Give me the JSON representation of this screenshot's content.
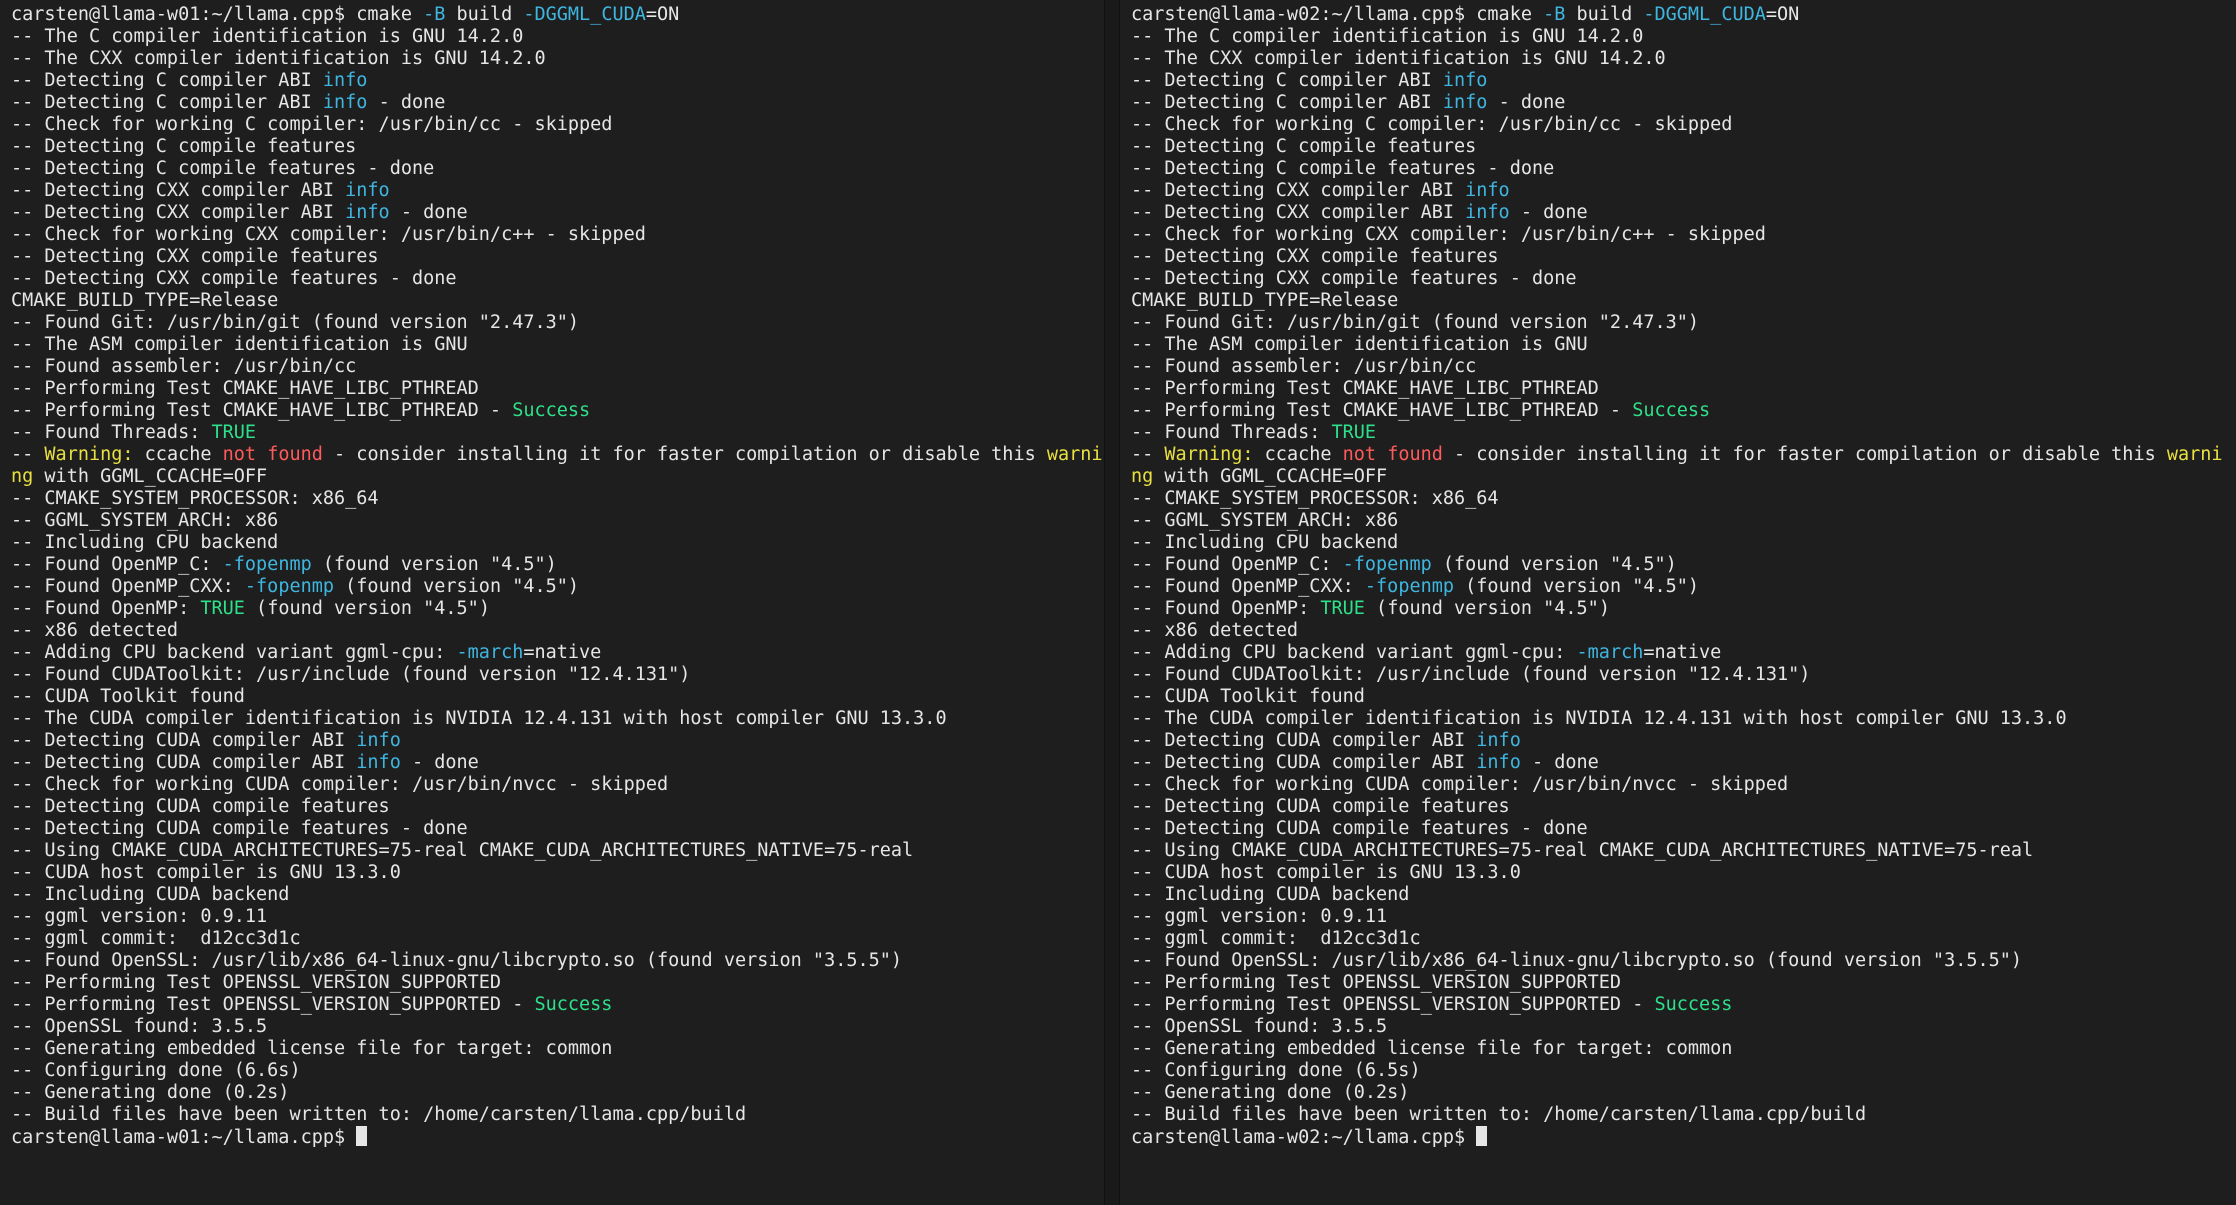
{
  "theme": {
    "background": "#1e1e1e",
    "foreground": "#e6e6e6",
    "info_color": "#3fb6e0",
    "success_color": "#2fe08a",
    "warning_color": "#e8e040",
    "error_color": "#ff5b5b"
  },
  "panes": [
    {
      "host": "llama-w01",
      "lines": [
        [
          {
            "t": "carsten@llama-w01:~/llama.cpp$ cmake "
          },
          {
            "t": "-B",
            "c": "cyan"
          },
          {
            "t": " build "
          },
          {
            "t": "-DGGML_CUDA",
            "c": "cyan"
          },
          {
            "t": "=ON"
          }
        ],
        [
          {
            "t": "-- The C compiler identification is GNU 14.2.0"
          }
        ],
        [
          {
            "t": "-- The CXX compiler identification is GNU 14.2.0"
          }
        ],
        [
          {
            "t": "-- Detecting C compiler ABI "
          },
          {
            "t": "info",
            "c": "cyan"
          }
        ],
        [
          {
            "t": "-- Detecting C compiler ABI "
          },
          {
            "t": "info",
            "c": "cyan"
          },
          {
            "t": " - done"
          }
        ],
        [
          {
            "t": "-- Check for working C compiler: /usr/bin/cc - skipped"
          }
        ],
        [
          {
            "t": "-- Detecting C compile features"
          }
        ],
        [
          {
            "t": "-- Detecting C compile features - done"
          }
        ],
        [
          {
            "t": "-- Detecting CXX compiler ABI "
          },
          {
            "t": "info",
            "c": "cyan"
          }
        ],
        [
          {
            "t": "-- Detecting CXX compiler ABI "
          },
          {
            "t": "info",
            "c": "cyan"
          },
          {
            "t": " - done"
          }
        ],
        [
          {
            "t": "-- Check for working CXX compiler: /usr/bin/c++ - skipped"
          }
        ],
        [
          {
            "t": "-- Detecting CXX compile features"
          }
        ],
        [
          {
            "t": "-- Detecting CXX compile features - done"
          }
        ],
        [
          {
            "t": "CMAKE_BUILD_TYPE=Release"
          }
        ],
        [
          {
            "t": "-- Found Git: /usr/bin/git (found version \"2.47.3\")"
          }
        ],
        [
          {
            "t": "-- The ASM compiler identification is GNU"
          }
        ],
        [
          {
            "t": "-- Found assembler: /usr/bin/cc"
          }
        ],
        [
          {
            "t": "-- Performing Test CMAKE_HAVE_LIBC_PTHREAD"
          }
        ],
        [
          {
            "t": "-- Performing Test CMAKE_HAVE_LIBC_PTHREAD - "
          },
          {
            "t": "Success",
            "c": "green"
          }
        ],
        [
          {
            "t": "-- Found Threads: "
          },
          {
            "t": "TRUE",
            "c": "green"
          }
        ],
        [
          {
            "t": "-- "
          },
          {
            "t": "Warning:",
            "c": "yellow"
          },
          {
            "t": " ccache "
          },
          {
            "t": "not found",
            "c": "red"
          },
          {
            "t": " - consider installing it for faster compilation or disable this "
          },
          {
            "t": "warni",
            "c": "yellow"
          }
        ],
        [
          {
            "t": "ng",
            "c": "yellow"
          },
          {
            "t": " with GGML_CCACHE=OFF"
          }
        ],
        [
          {
            "t": "-- CMAKE_SYSTEM_PROCESSOR: x86_64"
          }
        ],
        [
          {
            "t": "-- GGML_SYSTEM_ARCH: x86"
          }
        ],
        [
          {
            "t": "-- Including CPU backend"
          }
        ],
        [
          {
            "t": "-- Found OpenMP_C: "
          },
          {
            "t": "-fopenmp",
            "c": "cyan"
          },
          {
            "t": " (found version \"4.5\")"
          }
        ],
        [
          {
            "t": "-- Found OpenMP_CXX: "
          },
          {
            "t": "-fopenmp",
            "c": "cyan"
          },
          {
            "t": " (found version \"4.5\")"
          }
        ],
        [
          {
            "t": "-- Found OpenMP: "
          },
          {
            "t": "TRUE",
            "c": "green"
          },
          {
            "t": " (found version \"4.5\")"
          }
        ],
        [
          {
            "t": "-- x86 detected"
          }
        ],
        [
          {
            "t": "-- Adding CPU backend variant ggml-cpu: "
          },
          {
            "t": "-march",
            "c": "cyan"
          },
          {
            "t": "=native"
          }
        ],
        [
          {
            "t": "-- Found CUDAToolkit: /usr/include (found version \"12.4.131\")"
          }
        ],
        [
          {
            "t": "-- CUDA Toolkit found"
          }
        ],
        [
          {
            "t": "-- The CUDA compiler identification is NVIDIA 12.4.131 with host compiler GNU 13.3.0"
          }
        ],
        [
          {
            "t": "-- Detecting CUDA compiler ABI "
          },
          {
            "t": "info",
            "c": "cyan"
          }
        ],
        [
          {
            "t": "-- Detecting CUDA compiler ABI "
          },
          {
            "t": "info",
            "c": "cyan"
          },
          {
            "t": " - done"
          }
        ],
        [
          {
            "t": "-- Check for working CUDA compiler: /usr/bin/nvcc - skipped"
          }
        ],
        [
          {
            "t": "-- Detecting CUDA compile features"
          }
        ],
        [
          {
            "t": "-- Detecting CUDA compile features - done"
          }
        ],
        [
          {
            "t": "-- Using CMAKE_CUDA_ARCHITECTURES=75-real CMAKE_CUDA_ARCHITECTURES_NATIVE=75-real"
          }
        ],
        [
          {
            "t": "-- CUDA host compiler is GNU 13.3.0"
          }
        ],
        [
          {
            "t": "-- Including CUDA backend"
          }
        ],
        [
          {
            "t": "-- ggml version: 0.9.11"
          }
        ],
        [
          {
            "t": "-- ggml commit:  d12cc3d1c"
          }
        ],
        [
          {
            "t": "-- Found OpenSSL: /usr/lib/x86_64-linux-gnu/libcrypto.so (found version \"3.5.5\")"
          }
        ],
        [
          {
            "t": "-- Performing Test OPENSSL_VERSION_SUPPORTED"
          }
        ],
        [
          {
            "t": "-- Performing Test OPENSSL_VERSION_SUPPORTED - "
          },
          {
            "t": "Success",
            "c": "green"
          }
        ],
        [
          {
            "t": "-- OpenSSL found: 3.5.5"
          }
        ],
        [
          {
            "t": "-- Generating embedded license file for target: common"
          }
        ],
        [
          {
            "t": "-- Configuring done (6.6s)"
          }
        ],
        [
          {
            "t": "-- Generating done (0.2s)"
          }
        ],
        [
          {
            "t": "-- Build files have been written to: /home/carsten/llama.cpp/build"
          }
        ]
      ],
      "prompt": "carsten@llama-w01:~/llama.cpp$ "
    },
    {
      "host": "llama-w02",
      "lines": [
        [
          {
            "t": "carsten@llama-w02:~/llama.cpp$ cmake "
          },
          {
            "t": "-B",
            "c": "cyan"
          },
          {
            "t": " build "
          },
          {
            "t": "-DGGML_CUDA",
            "c": "cyan"
          },
          {
            "t": "=ON"
          }
        ],
        [
          {
            "t": "-- The C compiler identification is GNU 14.2.0"
          }
        ],
        [
          {
            "t": "-- The CXX compiler identification is GNU 14.2.0"
          }
        ],
        [
          {
            "t": "-- Detecting C compiler ABI "
          },
          {
            "t": "info",
            "c": "cyan"
          }
        ],
        [
          {
            "t": "-- Detecting C compiler ABI "
          },
          {
            "t": "info",
            "c": "cyan"
          },
          {
            "t": " - done"
          }
        ],
        [
          {
            "t": "-- Check for working C compiler: /usr/bin/cc - skipped"
          }
        ],
        [
          {
            "t": "-- Detecting C compile features"
          }
        ],
        [
          {
            "t": "-- Detecting C compile features - done"
          }
        ],
        [
          {
            "t": "-- Detecting CXX compiler ABI "
          },
          {
            "t": "info",
            "c": "cyan"
          }
        ],
        [
          {
            "t": "-- Detecting CXX compiler ABI "
          },
          {
            "t": "info",
            "c": "cyan"
          },
          {
            "t": " - done"
          }
        ],
        [
          {
            "t": "-- Check for working CXX compiler: /usr/bin/c++ - skipped"
          }
        ],
        [
          {
            "t": "-- Detecting CXX compile features"
          }
        ],
        [
          {
            "t": "-- Detecting CXX compile features - done"
          }
        ],
        [
          {
            "t": "CMAKE_BUILD_TYPE=Release"
          }
        ],
        [
          {
            "t": "-- Found Git: /usr/bin/git (found version \"2.47.3\")"
          }
        ],
        [
          {
            "t": "-- The ASM compiler identification is GNU"
          }
        ],
        [
          {
            "t": "-- Found assembler: /usr/bin/cc"
          }
        ],
        [
          {
            "t": "-- Performing Test CMAKE_HAVE_LIBC_PTHREAD"
          }
        ],
        [
          {
            "t": "-- Performing Test CMAKE_HAVE_LIBC_PTHREAD - "
          },
          {
            "t": "Success",
            "c": "green"
          }
        ],
        [
          {
            "t": "-- Found Threads: "
          },
          {
            "t": "TRUE",
            "c": "green"
          }
        ],
        [
          {
            "t": "-- "
          },
          {
            "t": "Warning:",
            "c": "yellow"
          },
          {
            "t": " ccache "
          },
          {
            "t": "not found",
            "c": "red"
          },
          {
            "t": " - consider installing it for faster compilation or disable this "
          },
          {
            "t": "warni",
            "c": "yellow"
          }
        ],
        [
          {
            "t": "ng",
            "c": "yellow"
          },
          {
            "t": " with GGML_CCACHE=OFF"
          }
        ],
        [
          {
            "t": "-- CMAKE_SYSTEM_PROCESSOR: x86_64"
          }
        ],
        [
          {
            "t": "-- GGML_SYSTEM_ARCH: x86"
          }
        ],
        [
          {
            "t": "-- Including CPU backend"
          }
        ],
        [
          {
            "t": "-- Found OpenMP_C: "
          },
          {
            "t": "-fopenmp",
            "c": "cyan"
          },
          {
            "t": " (found version \"4.5\")"
          }
        ],
        [
          {
            "t": "-- Found OpenMP_CXX: "
          },
          {
            "t": "-fopenmp",
            "c": "cyan"
          },
          {
            "t": " (found version \"4.5\")"
          }
        ],
        [
          {
            "t": "-- Found OpenMP: "
          },
          {
            "t": "TRUE",
            "c": "green"
          },
          {
            "t": " (found version \"4.5\")"
          }
        ],
        [
          {
            "t": "-- x86 detected"
          }
        ],
        [
          {
            "t": "-- Adding CPU backend variant ggml-cpu: "
          },
          {
            "t": "-march",
            "c": "cyan"
          },
          {
            "t": "=native"
          }
        ],
        [
          {
            "t": "-- Found CUDAToolkit: /usr/include (found version \"12.4.131\")"
          }
        ],
        [
          {
            "t": "-- CUDA Toolkit found"
          }
        ],
        [
          {
            "t": "-- The CUDA compiler identification is NVIDIA 12.4.131 with host compiler GNU 13.3.0"
          }
        ],
        [
          {
            "t": "-- Detecting CUDA compiler ABI "
          },
          {
            "t": "info",
            "c": "cyan"
          }
        ],
        [
          {
            "t": "-- Detecting CUDA compiler ABI "
          },
          {
            "t": "info",
            "c": "cyan"
          },
          {
            "t": " - done"
          }
        ],
        [
          {
            "t": "-- Check for working CUDA compiler: /usr/bin/nvcc - skipped"
          }
        ],
        [
          {
            "t": "-- Detecting CUDA compile features"
          }
        ],
        [
          {
            "t": "-- Detecting CUDA compile features - done"
          }
        ],
        [
          {
            "t": "-- Using CMAKE_CUDA_ARCHITECTURES=75-real CMAKE_CUDA_ARCHITECTURES_NATIVE=75-real"
          }
        ],
        [
          {
            "t": "-- CUDA host compiler is GNU 13.3.0"
          }
        ],
        [
          {
            "t": "-- Including CUDA backend"
          }
        ],
        [
          {
            "t": "-- ggml version: 0.9.11"
          }
        ],
        [
          {
            "t": "-- ggml commit:  d12cc3d1c"
          }
        ],
        [
          {
            "t": "-- Found OpenSSL: /usr/lib/x86_64-linux-gnu/libcrypto.so (found version \"3.5.5\")"
          }
        ],
        [
          {
            "t": "-- Performing Test OPENSSL_VERSION_SUPPORTED"
          }
        ],
        [
          {
            "t": "-- Performing Test OPENSSL_VERSION_SUPPORTED - "
          },
          {
            "t": "Success",
            "c": "green"
          }
        ],
        [
          {
            "t": "-- OpenSSL found: 3.5.5"
          }
        ],
        [
          {
            "t": "-- Generating embedded license file for target: common"
          }
        ],
        [
          {
            "t": "-- Configuring done (6.5s)"
          }
        ],
        [
          {
            "t": "-- Generating done (0.2s)"
          }
        ],
        [
          {
            "t": "-- Build files have been written to: /home/carsten/llama.cpp/build"
          }
        ]
      ],
      "prompt": "carsten@llama-w02:~/llama.cpp$ "
    }
  ]
}
